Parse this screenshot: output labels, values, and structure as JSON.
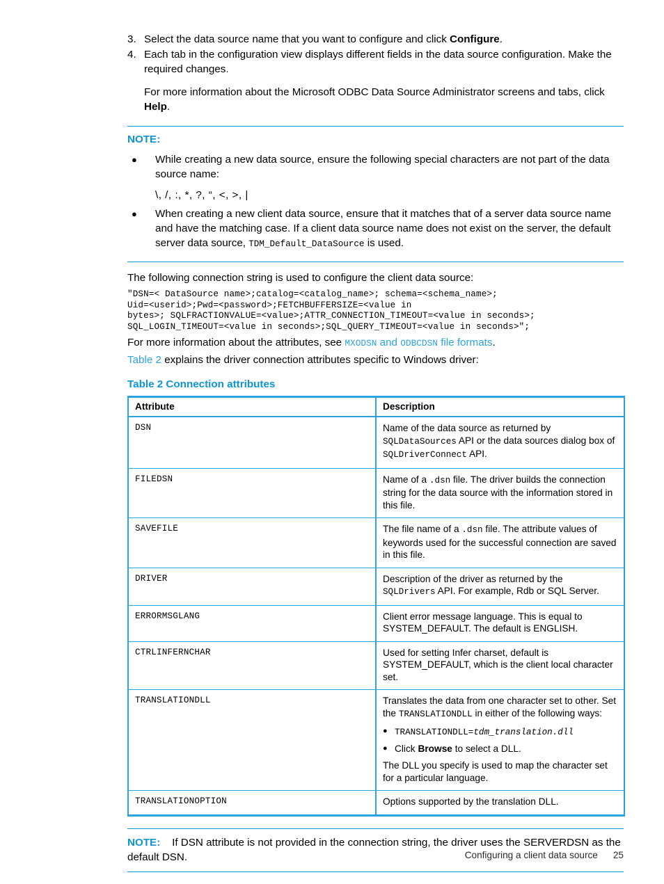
{
  "steps": [
    {
      "num": "3.",
      "text_before": "Select the data source name that you want to configure and click ",
      "bold": "Configure",
      "text_after": "."
    },
    {
      "num": "4.",
      "text_before": "Each tab in the configuration view displays different fields in the data source configuration. Make the required changes.",
      "bold": "",
      "text_after": ""
    }
  ],
  "step4_sub": {
    "text_before": "For more information about the Microsoft ODBC Data Source Administrator screens and tabs, click ",
    "bold": "Help",
    "text_after": "."
  },
  "note_top": {
    "title": "NOTE:",
    "bullets": [
      "While creating a new data source, ensure the following special characters are not part of the data source name:",
      "When creating a new client data source, ensure that it matches that of a server data source name and have the matching case. If a client data source name does not exist on the server, the default server data source, "
    ],
    "special_characters": "\\, /, :, *, ?, “, <, >, |",
    "bullet2_code": "TDM_Default_DataSource",
    "bullet2_tail": " is used."
  },
  "connection": {
    "intro": "The following connection string is used to configure the client data source:",
    "code": "\"DSN=< DataSource name>;catalog=<catalog_name>; schema=<schema_name>;\nUid=<userid>;Pwd=<password>;FETCHBUFFERSIZE=<value in\nbytes>; SQLFRACTIONVALUE=<value>;ATTR_CONNECTION_TIMEOUT=<value in seconds>;\nSQL_LOGIN_TIMEOUT=<value in seconds>;SQL_QUERY_TIMEOUT=<value in seconds>\";",
    "more_info_prefix": "For more information about the attributes, see ",
    "link_mxodsn": "MXODSN",
    "link_and": " and ",
    "link_odbcdsn": "ODBCDSN",
    "link_suffix": " file formats",
    "more_info_period": ".",
    "table_ref": "Table 2",
    "table_ref_tail": " explains the driver connection attributes specific to Windows driver:"
  },
  "table": {
    "caption": "Table 2 Connection attributes",
    "headers": [
      "Attribute",
      "Description"
    ],
    "rows": [
      {
        "attribute": "DSN",
        "desc_lines": [
          "Name of the data source as returned by",
          "SQLDataSources API or the data sources dialog box",
          "of SQLDriverConnect API."
        ],
        "desc_parts": [
          {
            "t": "Name of the data source as returned by "
          },
          {
            "t": "SQLDataSources",
            "mono": true
          },
          {
            "t": " API or the data sources dialog box of "
          },
          {
            "t": "SQLDriverConnect",
            "mono": true
          },
          {
            "t": " API."
          }
        ]
      },
      {
        "attribute": "FILEDSN",
        "desc_parts": [
          {
            "t": "Name of a "
          },
          {
            "t": ".dsn",
            "mono": true
          },
          {
            "t": " file. The driver builds the connection string for the data source with the information stored in this file."
          }
        ]
      },
      {
        "attribute": "SAVEFILE",
        "desc_parts": [
          {
            "t": "The file name of a "
          },
          {
            "t": ".dsn",
            "mono": true
          },
          {
            "t": " file. The attribute values of keywords used for the successful connection are saved in this file."
          }
        ]
      },
      {
        "attribute": "DRIVER",
        "desc_parts": [
          {
            "t": "Description of the driver as returned by the "
          },
          {
            "t": "SQLDrivers",
            "mono": true
          },
          {
            "t": " API. For example, Rdb or SQL Server."
          }
        ]
      },
      {
        "attribute": "ERRORMSGLANG",
        "desc_parts": [
          {
            "t": "Client error message language. This is equal to SYSTEM_DEFAULT. The default is ENGLISH."
          }
        ]
      },
      {
        "attribute": "CTRLINFERNCHAR",
        "desc_parts": [
          {
            "t": "Used for setting Infer charset, default is SYSTEM_DEFAULT, which is the client local character set."
          }
        ]
      },
      {
        "attribute": "TRANSLATIONDLL",
        "desc_parts": [
          {
            "t": "Translates the data from one character set to other. Set the "
          },
          {
            "t": "TRANSLATIONDLL",
            "mono": true
          },
          {
            "t": " in either of the following ways:"
          }
        ],
        "sub_bullets": [
          {
            "parts": [
              {
                "t": "TRANSLATIONDLL=",
                "mono": true
              },
              {
                "t": "tdm_translation.dll",
                "mono_italic": true
              }
            ]
          },
          {
            "parts": [
              {
                "t": "Click "
              },
              {
                "t": "Browse",
                "bold": true
              },
              {
                "t": " to select a DLL."
              }
            ]
          }
        ],
        "trailing": "The DLL you specify is used to map the character set for a particular language."
      },
      {
        "attribute": "TRANSLATIONOPTION",
        "desc_parts": [
          {
            "t": "Options supported by the translation DLL."
          }
        ]
      }
    ]
  },
  "note_bottom": {
    "title": "NOTE:",
    "text": "If DSN attribute is not provided in the connection string, the driver uses the SERVERDSN as the default DSN."
  },
  "footer": {
    "section": "Configuring a client data source",
    "page": "25"
  },
  "colors": {
    "accent_blue": "#0d94d4",
    "table_border": "#2aa3e0",
    "link": "#2aa3e0",
    "text": "#000000"
  }
}
